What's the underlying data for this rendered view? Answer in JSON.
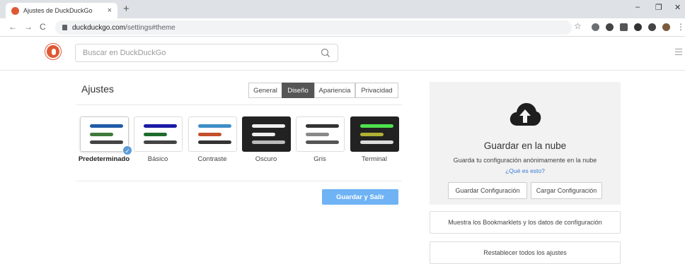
{
  "browser": {
    "tab_title": "Ajustes de DuckDuckGo",
    "tab_close": "×",
    "new_tab": "+",
    "url_host": "duckduckgo.com",
    "url_path": "/settings#theme",
    "back": "←",
    "forward": "→",
    "reload": "C",
    "minimize": "–",
    "maximize": "❐",
    "close": "✕",
    "bookmark_star": "☆",
    "menu_dots": "⋮"
  },
  "header": {
    "search_placeholder": "Buscar en DuckDuckGo"
  },
  "settings": {
    "title": "Ajustes",
    "tabs": [
      {
        "label": "General"
      },
      {
        "label": "Diseño"
      },
      {
        "label": "Apariencia"
      },
      {
        "label": "Privacidad"
      }
    ],
    "active_tab": "Diseño",
    "themes": [
      {
        "label": "Predeterminado",
        "selected": true,
        "bg": "#ffffff",
        "bars": [
          "#1f5ba8",
          "#3f7a3b",
          "#444444"
        ]
      },
      {
        "label": "Básico",
        "selected": false,
        "bg": "#ffffff",
        "bars": [
          "#1a1aa6",
          "#1e6b2e",
          "#444444"
        ]
      },
      {
        "label": "Contraste",
        "selected": false,
        "bg": "#ffffff",
        "bars": [
          "#3d8fc7",
          "#c4502c",
          "#333333"
        ]
      },
      {
        "label": "Oscuro",
        "selected": false,
        "bg": "#222222",
        "bars": [
          "#eeeeee",
          "#eeeeee",
          "#bbbbbb"
        ]
      },
      {
        "label": "Gris",
        "selected": false,
        "bg": "#ffffff",
        "bars": [
          "#333333",
          "#888888",
          "#555555"
        ]
      },
      {
        "label": "Terminal",
        "selected": false,
        "bg": "#222222",
        "bars": [
          "#4ee24e",
          "#b0b033",
          "#dddddd"
        ]
      }
    ],
    "save_exit": "Guardar y Salir"
  },
  "cloud": {
    "title": "Guardar en la nube",
    "subtitle": "Guarda tu configuración anónimamente en la nube",
    "link": "¿Qué es esto?",
    "save_config": "Guardar Configuración",
    "load_config": "Cargar Configuración"
  },
  "extra": {
    "bookmarklets": "Muestra los Bookmarklets y los datos de configuración",
    "reset": "Restablecer todos los ajustes"
  }
}
